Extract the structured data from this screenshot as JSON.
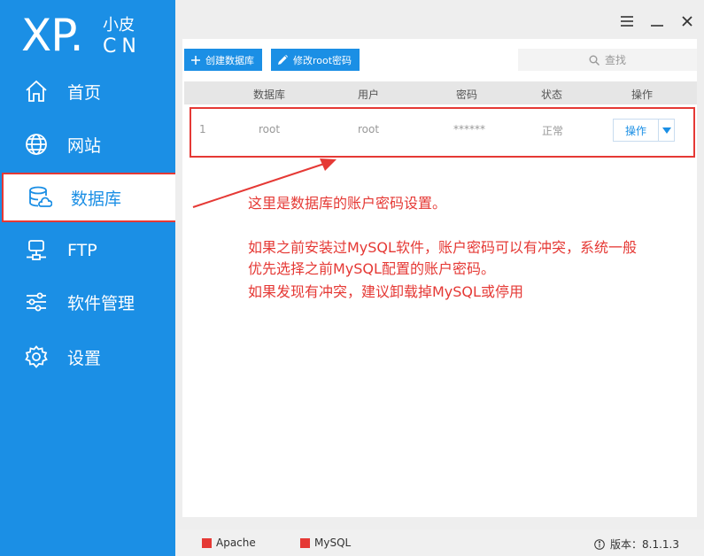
{
  "brand": {
    "logo_main": "XP.",
    "logo_zh": "小皮",
    "logo_cn": "CN"
  },
  "sidebar": {
    "items": [
      {
        "label": "首页",
        "icon": "home-icon"
      },
      {
        "label": "网站",
        "icon": "globe-icon"
      },
      {
        "label": "数据库",
        "icon": "database-icon",
        "active": true
      },
      {
        "label": "FTP",
        "icon": "server-icon"
      },
      {
        "label": "软件管理",
        "icon": "sliders-icon"
      },
      {
        "label": "设置",
        "icon": "gear-icon"
      }
    ]
  },
  "toolbar": {
    "create_db_label": "创建数据库",
    "change_root_label": "修改root密码",
    "search_placeholder": "查找"
  },
  "table": {
    "headers": [
      "数据库",
      "用户",
      "密码",
      "状态",
      "操作"
    ],
    "rows": [
      {
        "index": "1",
        "database": "root",
        "user": "root",
        "password": "******",
        "status": "正常",
        "action": "操作"
      }
    ]
  },
  "annotation": {
    "line1": "这里是数据库的账户密码设置。",
    "line2": "如果之前安装过MySQL软件，账户密码可以有冲突，系统一般",
    "line3": "优先选择之前MySQL配置的账户密码。",
    "line4": "如果发现有冲突，建议卸载掉MySQL或停用"
  },
  "status_bar": {
    "services": [
      "Apache",
      "MySQL"
    ],
    "version_label": "版本：",
    "version": "8.1.1.3"
  },
  "colors": {
    "accent": "#1b8fe5",
    "highlight": "#e53935",
    "service_stopped": "#e53935"
  }
}
